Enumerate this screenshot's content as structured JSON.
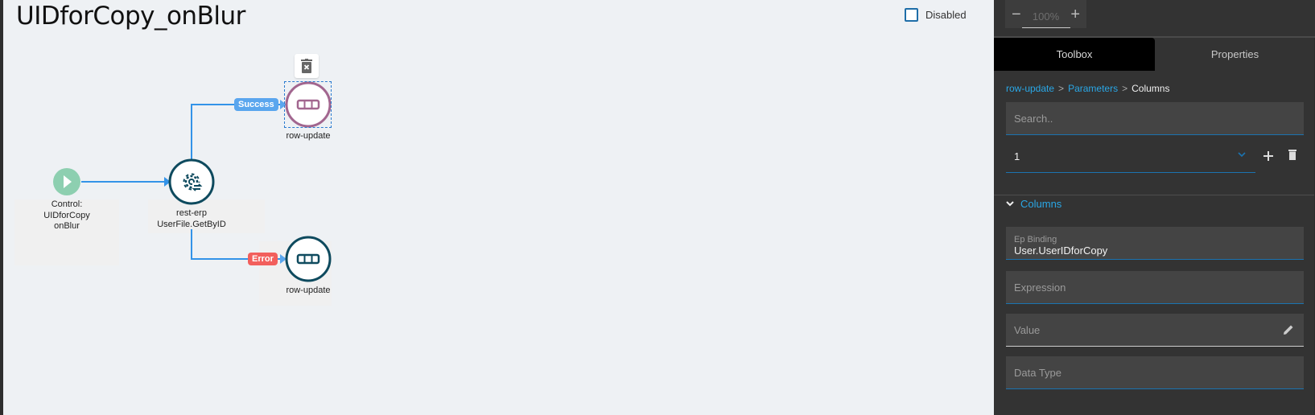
{
  "canvas": {
    "title": "UIDforCopy_onBlur",
    "disabled_label": "Disabled",
    "disabled_checked": false,
    "nodes": [
      {
        "id": "start",
        "type": "control",
        "label_lines": [
          "Control:",
          "UIDforCopy",
          "onBlur"
        ],
        "icon": "play-icon",
        "color": "#8dcfb0"
      },
      {
        "id": "rest",
        "type": "rest-erp",
        "label_lines": [
          "rest-erp",
          "UserFile.GetByID"
        ],
        "icon": "gear-sync-icon",
        "color": "#0e4a5e"
      },
      {
        "id": "success-row",
        "type": "row-update",
        "label_lines": [
          "row-update"
        ],
        "icon": "row-icon",
        "color": "#a2668f",
        "selected": true
      },
      {
        "id": "error-row",
        "type": "row-update",
        "label_lines": [
          "row-update"
        ],
        "icon": "row-icon",
        "color": "#0e4a5e"
      }
    ],
    "edges": [
      {
        "from": "start",
        "to": "rest",
        "label": ""
      },
      {
        "from": "rest",
        "to": "success-row",
        "label": "Success",
        "color": "#5aa6ee"
      },
      {
        "from": "rest",
        "to": "error-row",
        "label": "Error",
        "color": "#f25f5c"
      }
    ],
    "edge_color": "#3393e8"
  },
  "panel": {
    "zoom": {
      "minus": "−",
      "value": "100%",
      "plus": "+"
    },
    "tabs": [
      {
        "label": "Toolbox",
        "active": true
      },
      {
        "label": "Properties",
        "active": false
      }
    ],
    "breadcrumb": [
      {
        "label": "row-update",
        "link": true
      },
      {
        "label": "Parameters",
        "link": true
      },
      {
        "label": "Columns",
        "link": false
      }
    ],
    "breadcrumb_sep": ">",
    "search": {
      "placeholder": "Search..",
      "value": ""
    },
    "select": {
      "value": "1"
    },
    "section": {
      "label": "Columns",
      "expanded": true
    },
    "fields": {
      "ep_binding": {
        "label": "Ep Binding",
        "value": "User.UserIDforCopy"
      },
      "expression": {
        "placeholder": "Expression",
        "value": ""
      },
      "value": {
        "placeholder": "Value",
        "value": ""
      },
      "data_type": {
        "placeholder": "Data Type",
        "value": ""
      }
    },
    "accent": "#2aa7e6"
  }
}
